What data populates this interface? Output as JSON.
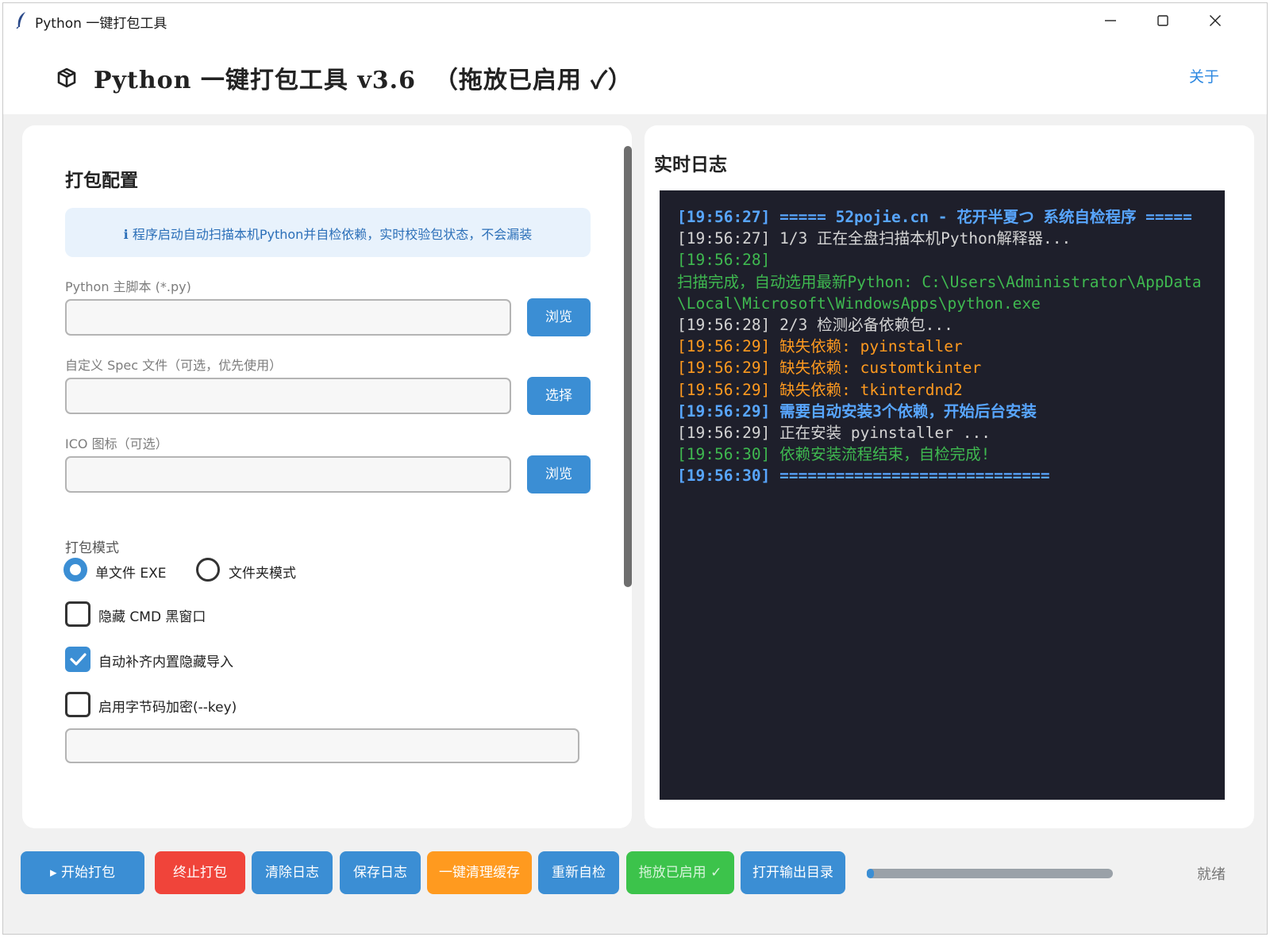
{
  "window": {
    "title": "Python 一键打包工具"
  },
  "header": {
    "title": "Python 一键打包工具 v3.6  （拖放已启用 ✓）",
    "about": "关于"
  },
  "config": {
    "section_title": "打包配置",
    "info": "ℹ 程序启动自动扫描本机Python并自检依赖，实时校验包状态，不会漏装",
    "script_label": "Python 主脚本 (*.py)",
    "script_value": "",
    "script_button": "浏览",
    "spec_label": "自定义 Spec 文件（可选，优先使用）",
    "spec_value": "",
    "spec_button": "选择",
    "ico_label": "ICO 图标（可选）",
    "ico_value": "",
    "ico_button": "浏览",
    "mode_label": "打包模式",
    "mode_single": "单文件 EXE",
    "mode_folder": "文件夹模式",
    "mode_selected": "single",
    "hide_cmd": {
      "label": "隐藏 CMD 黑窗口",
      "checked": false
    },
    "hidden_imports": {
      "label": "自动补齐内置隐藏导入",
      "checked": true
    },
    "encrypt": {
      "label": "启用字节码加密(--key)",
      "checked": false
    },
    "key_value": ""
  },
  "log": {
    "title": "实时日志",
    "lines": [
      {
        "text": "[19:56:27] ===== 52pojie.cn - 花开半夏つ 系统自检程序 =====",
        "color": "#58a6ff",
        "bold": true
      },
      {
        "text": "[19:56:27] 1/3 正在全盘扫描本机Python解释器...",
        "color": "#d4d4d4",
        "bold": false
      },
      {
        "text": "[19:56:28]",
        "color": "#3fb950",
        "bold": false
      },
      {
        "text": "扫描完成，自动选用最新Python: C:\\Users\\Administrator\\AppData\\Local\\Microsoft\\WindowsApps\\python.exe",
        "color": "#3fb950",
        "bold": false
      },
      {
        "text": "[19:56:28] 2/3 检测必备依赖包...",
        "color": "#d4d4d4",
        "bold": false
      },
      {
        "text": "[19:56:29] 缺失依赖: pyinstaller",
        "color": "#ff9a1f",
        "bold": false
      },
      {
        "text": "[19:56:29] 缺失依赖: customtkinter",
        "color": "#ff9a1f",
        "bold": false
      },
      {
        "text": "[19:56:29] 缺失依赖: tkinterdnd2",
        "color": "#ff9a1f",
        "bold": false
      },
      {
        "text": "[19:56:29] 需要自动安装3个依赖，开始后台安装",
        "color": "#58a6ff",
        "bold": true
      },
      {
        "text": "[19:56:29] 正在安装 pyinstaller ...",
        "color": "#d4d4d4",
        "bold": false
      },
      {
        "text": "[19:56:30] 依赖安装流程结束，自检完成!",
        "color": "#3fb950",
        "bold": false
      },
      {
        "text": "[19:56:30] =============================",
        "color": "#58a6ff",
        "bold": true
      }
    ]
  },
  "toolbar": {
    "start": "▸ 开始打包",
    "stop": "终止打包",
    "clear_log": "清除日志",
    "save_log": "保存日志",
    "clean_cache": "一键清理缓存",
    "recheck": "重新自检",
    "drag_enabled": "拖放已启用 ✓",
    "open_output": "打开输出目录",
    "progress": 0.03,
    "status": "就绪"
  },
  "colors": {
    "accent": "#3b8ed4",
    "danger": "#f0443a",
    "warning": "#ff9a1f",
    "success": "#3cc34b",
    "log_bg": "#1e1f2b"
  },
  "icons": {
    "app": "feather-icon",
    "header": "package-icon",
    "check": "checkmark-icon"
  }
}
